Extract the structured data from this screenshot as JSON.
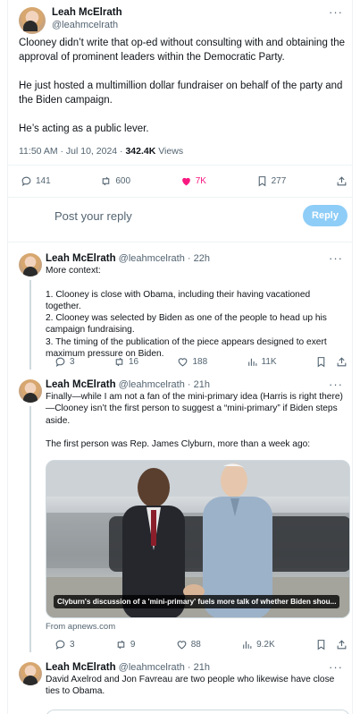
{
  "main_tweet": {
    "name": "Leah McElrath",
    "handle": "@leahmcelrath",
    "more": "···",
    "paragraphs": [
      "Clooney didn’t write that op-ed without consulting with and obtaining the approval of prominent leaders within the Democratic Party.",
      "He just hosted a multimillion dollar fundraiser on behalf of the party and the Biden campaign.",
      "He’s acting as a public lever."
    ],
    "time": "11:50 AM · Jul 10, 2024 · ",
    "views_count": "342.4K",
    "views_label": " Views",
    "stats": {
      "replies": "141",
      "reposts": "600",
      "likes": "7K",
      "bookmarks": "277"
    },
    "like_color": "#f91880"
  },
  "reply_box": {
    "placeholder": "Post your reply",
    "button": "Reply"
  },
  "replies": [
    {
      "name": "Leah McElrath",
      "handle": "@leahmcelrath",
      "time": " · 22h",
      "paragraphs": [
        "More context:",
        "1. Clooney is close with Obama, including their having vacationed together.\n2. Clooney was selected by Biden as one of the people to head up his campaign fundraising.\n3. The timing of the publication of the piece appears designed to exert maximum pressure on Biden."
      ],
      "stats": {
        "replies": "3",
        "reposts": "16",
        "likes": "188",
        "views": "11K"
      }
    },
    {
      "name": "Leah McElrath",
      "handle": "@leahmcelrath",
      "time": " · 21h",
      "paragraphs": [
        "Finally—while I am not a fan of the mini-primary idea (Harris is right there)—Clooney isn’t the first person to suggest a “mini-primary” if Biden steps aside.",
        "The first person was Rep. James Clyburn, more than a week ago:"
      ],
      "media_caption": "Clyburn's discussion of a 'mini-primary' fuels more talk of whether Biden shou...",
      "source": "From apnews.com",
      "stats": {
        "replies": "3",
        "reposts": "9",
        "likes": "88",
        "views": "9.2K"
      }
    },
    {
      "name": "Leah McElrath",
      "handle": "@leahmcelrath",
      "time": " · 21h",
      "paragraphs": [
        "David Axelrod and Jon Favreau are two people who likewise have close ties to Obama."
      ]
    }
  ]
}
